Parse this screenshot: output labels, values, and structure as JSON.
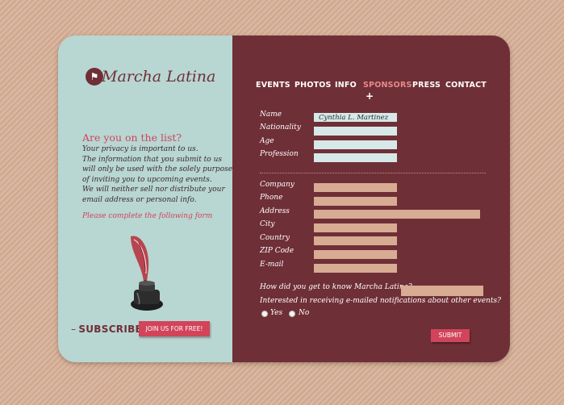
{
  "brand": {
    "name": "Marcha Latina",
    "logo_icon": "flag-icon"
  },
  "nav": {
    "items": [
      {
        "label": "EVENTS"
      },
      {
        "label": "PHOTOS"
      },
      {
        "label": "INFO"
      },
      {
        "label": "SPONSORS"
      },
      {
        "label": "PRESS"
      },
      {
        "label": "CONTACT"
      }
    ],
    "active": "SPONSORS",
    "active_marker": "+"
  },
  "sidebar": {
    "title": "Are you on the list?",
    "privacy_lines": [
      "Your privacy is important to us.",
      "The information that you submit to us",
      "will only be used with the solely purpose",
      "of inviting you to upcoming events.",
      "We will neither sell nor distribute your",
      "email address or personal info."
    ],
    "cta": "Please complete the following form",
    "subscribe_dash": "–",
    "subscribe_label": "SUBSCRIBE",
    "join_button": "JOIN US FOR FREE!"
  },
  "form": {
    "personal": [
      {
        "label": "Name",
        "value": "Cynthia L. Martinez"
      },
      {
        "label": "Nationality",
        "value": ""
      },
      {
        "label": "Age",
        "value": ""
      },
      {
        "label": "Profession",
        "value": ""
      }
    ],
    "contact": [
      {
        "label": "Company",
        "value": ""
      },
      {
        "label": "Phone",
        "value": ""
      },
      {
        "label": "Address",
        "value": ""
      },
      {
        "label": "City",
        "value": ""
      },
      {
        "label": "Country",
        "value": ""
      },
      {
        "label": "ZIP Code",
        "value": ""
      },
      {
        "label": "E-mail",
        "value": ""
      }
    ],
    "how_question": "How did you get to know Marcha Latina?",
    "notify_question": "Interested in receiving e-mailed notifications about other events?",
    "options": {
      "yes": "Yes",
      "no": "No"
    },
    "submit_label": "SUBMIT"
  },
  "colors": {
    "maroon": "#6f2f37",
    "pink": "#d2445a",
    "teal": "#b8d6d2",
    "tan_input": "#d8ab93",
    "blue_input": "#d6e8e7"
  }
}
